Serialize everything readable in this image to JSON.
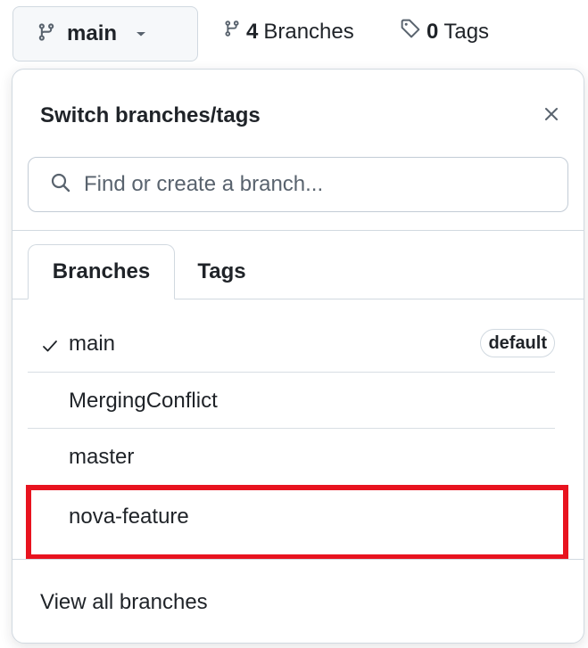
{
  "header": {
    "current_branch": "main",
    "branches_count": "4",
    "branches_label": "Branches",
    "tags_count": "0",
    "tags_label": "Tags"
  },
  "dropdown": {
    "title": "Switch branches/tags",
    "search_placeholder": "Find or create a branch...",
    "tabs": [
      {
        "label": "Branches",
        "active": true
      },
      {
        "label": "Tags",
        "active": false
      }
    ],
    "branches": [
      {
        "name": "main",
        "checked": true,
        "badge": "default"
      },
      {
        "name": "MergingConflict",
        "checked": false
      },
      {
        "name": "master",
        "checked": false
      },
      {
        "name": "nova-feature",
        "checked": false,
        "highlighted": true
      }
    ],
    "footer_link": "View all branches"
  },
  "colors": {
    "highlight_border": "#e8131f",
    "button_bg": "#f6f8fa",
    "border": "#d1d9e0",
    "text": "#1f2328"
  },
  "icons": [
    "git-branch-icon",
    "triangle-down-icon",
    "tag-icon",
    "close-icon",
    "search-icon",
    "check-icon"
  ]
}
